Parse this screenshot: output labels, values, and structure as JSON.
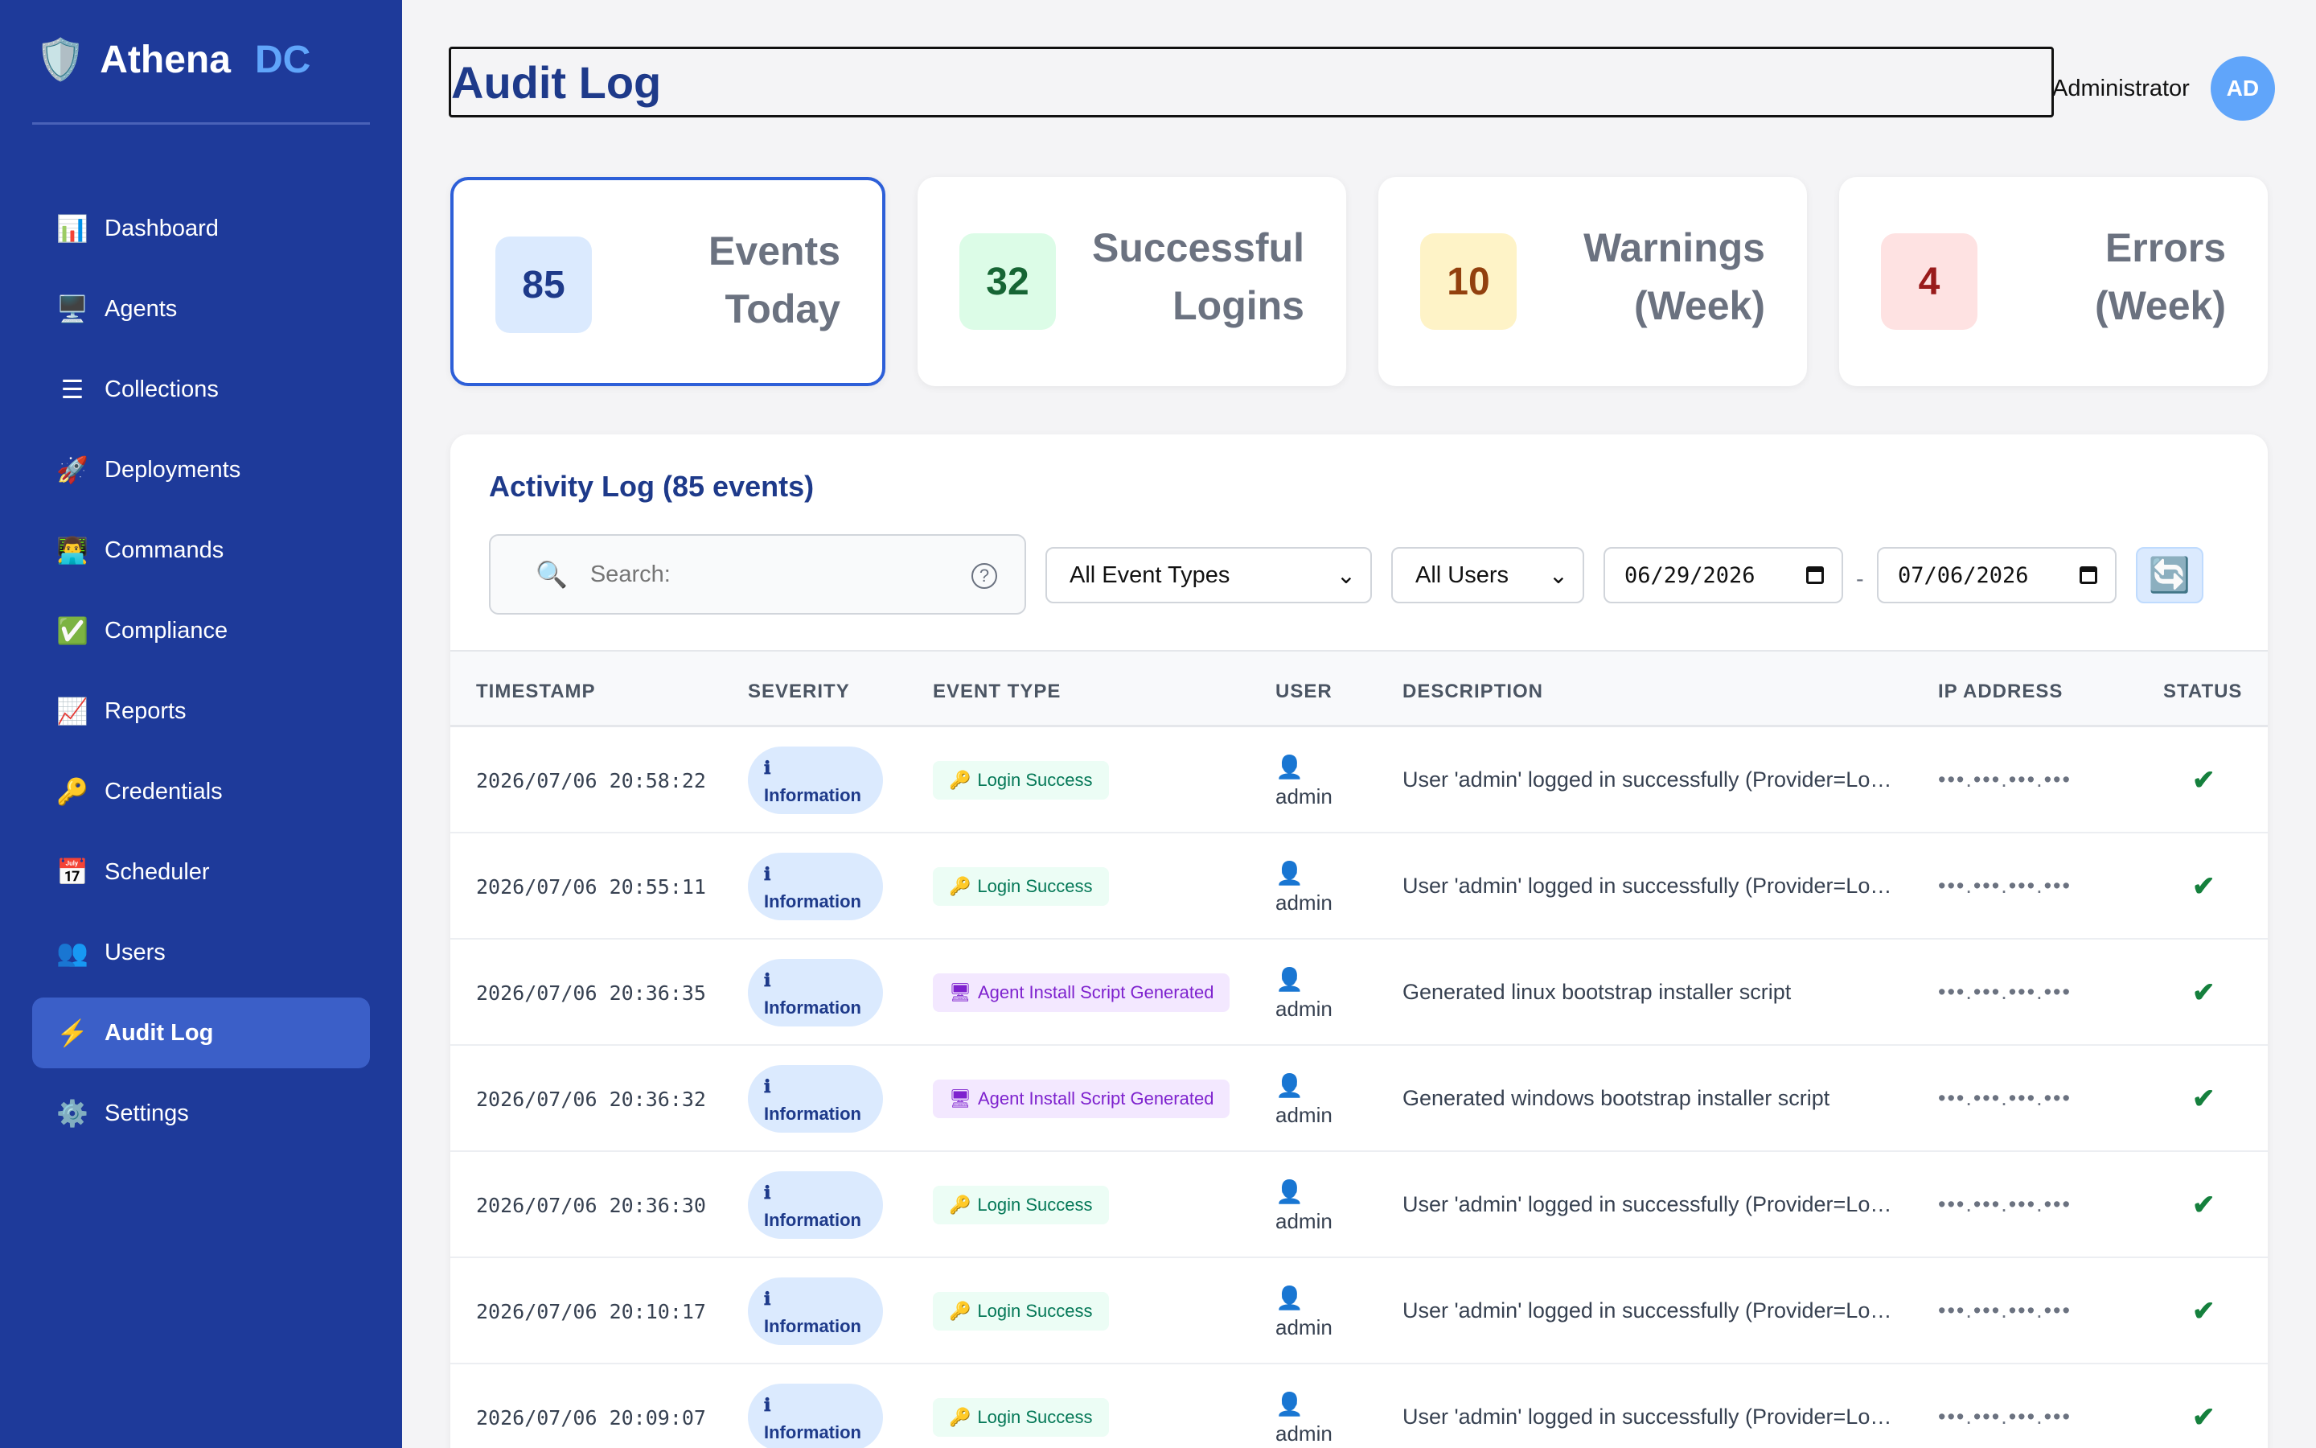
{
  "brand": {
    "icon": "shield-icon",
    "name": "Athena",
    "accent": "DC"
  },
  "nav": [
    {
      "icon": "📊",
      "label": "Dashboard"
    },
    {
      "icon": "🖥️",
      "label": "Agents"
    },
    {
      "icon": "☰",
      "label": "Collections"
    },
    {
      "icon": "🚀",
      "label": "Deployments"
    },
    {
      "icon": "👨‍💻",
      "label": "Commands"
    },
    {
      "icon": "✅",
      "label": "Compliance"
    },
    {
      "icon": "📈",
      "label": "Reports"
    },
    {
      "icon": "🔑",
      "label": "Credentials"
    },
    {
      "icon": "📅",
      "label": "Scheduler"
    },
    {
      "icon": "👥",
      "label": "Users"
    },
    {
      "icon": "⚡",
      "label": "Audit Log",
      "active": true
    },
    {
      "icon": "⚙️",
      "label": "Settings"
    }
  ],
  "header": {
    "title": "Audit Log",
    "user_name": "Administrator",
    "avatar_initials": "AD"
  },
  "stats": [
    {
      "value": "85",
      "label": "Events Today",
      "bg": "#dbeafe",
      "fg": "#1e3a8a"
    },
    {
      "value": "32",
      "label": "Successful Logins",
      "bg": "#dcfce7",
      "fg": "#166534"
    },
    {
      "value": "10",
      "label": "Warnings (Week)",
      "bg": "#fef3c7",
      "fg": "#92400e"
    },
    {
      "value": "4",
      "label": "Errors (Week)",
      "bg": "#fee2e2",
      "fg": "#991b1b"
    }
  ],
  "panel": {
    "title": "Activity Log (85 events)",
    "search_placeholder": "Search:",
    "event_type_filter": "All Event Types",
    "user_filter": "All Users",
    "date_from": "06/29/2026",
    "date_to": "07/06/2026",
    "date_separator": "-"
  },
  "columns": [
    "TIMESTAMP",
    "SEVERITY",
    "EVENT TYPE",
    "USER",
    "DESCRIPTION",
    "IP ADDRESS",
    "STATUS"
  ],
  "rows": [
    {
      "timestamp": "2026/07/06 20:58:22",
      "severity": "Information",
      "event": "Login Success",
      "event_kind": "login",
      "user": "admin",
      "description": "User 'admin' logged in successfully (Provider=Local)",
      "ip": "•••.•••.•••.•••",
      "status": "✔"
    },
    {
      "timestamp": "2026/07/06 20:55:11",
      "severity": "Information",
      "event": "Login Success",
      "event_kind": "login",
      "user": "admin",
      "description": "User 'admin' logged in successfully (Provider=Local)",
      "ip": "•••.•••.•••.•••",
      "status": "✔"
    },
    {
      "timestamp": "2026/07/06 20:36:35",
      "severity": "Information",
      "event": "Agent Install Script Generated",
      "event_kind": "script",
      "user": "admin",
      "description": "Generated linux bootstrap installer script",
      "ip": "•••.•••.•••.•••",
      "status": "✔"
    },
    {
      "timestamp": "2026/07/06 20:36:32",
      "severity": "Information",
      "event": "Agent Install Script Generated",
      "event_kind": "script",
      "user": "admin",
      "description": "Generated windows bootstrap installer script",
      "ip": "•••.•••.•••.•••",
      "status": "✔"
    },
    {
      "timestamp": "2026/07/06 20:36:30",
      "severity": "Information",
      "event": "Login Success",
      "event_kind": "login",
      "user": "admin",
      "description": "User 'admin' logged in successfully (Provider=Local)",
      "ip": "•••.•••.•••.•••",
      "status": "✔"
    },
    {
      "timestamp": "2026/07/06 20:10:17",
      "severity": "Information",
      "event": "Login Success",
      "event_kind": "login",
      "user": "admin",
      "description": "User 'admin' logged in successfully (Provider=Local)",
      "ip": "•••.•••.•••.•••",
      "status": "✔"
    },
    {
      "timestamp": "2026/07/06 20:09:07",
      "severity": "Information",
      "event": "Login Success",
      "event_kind": "login",
      "user": "admin",
      "description": "User 'admin' logged in successfully (Provider=Local)",
      "ip": "•••.•••.•••.•••",
      "status": "✔"
    }
  ]
}
